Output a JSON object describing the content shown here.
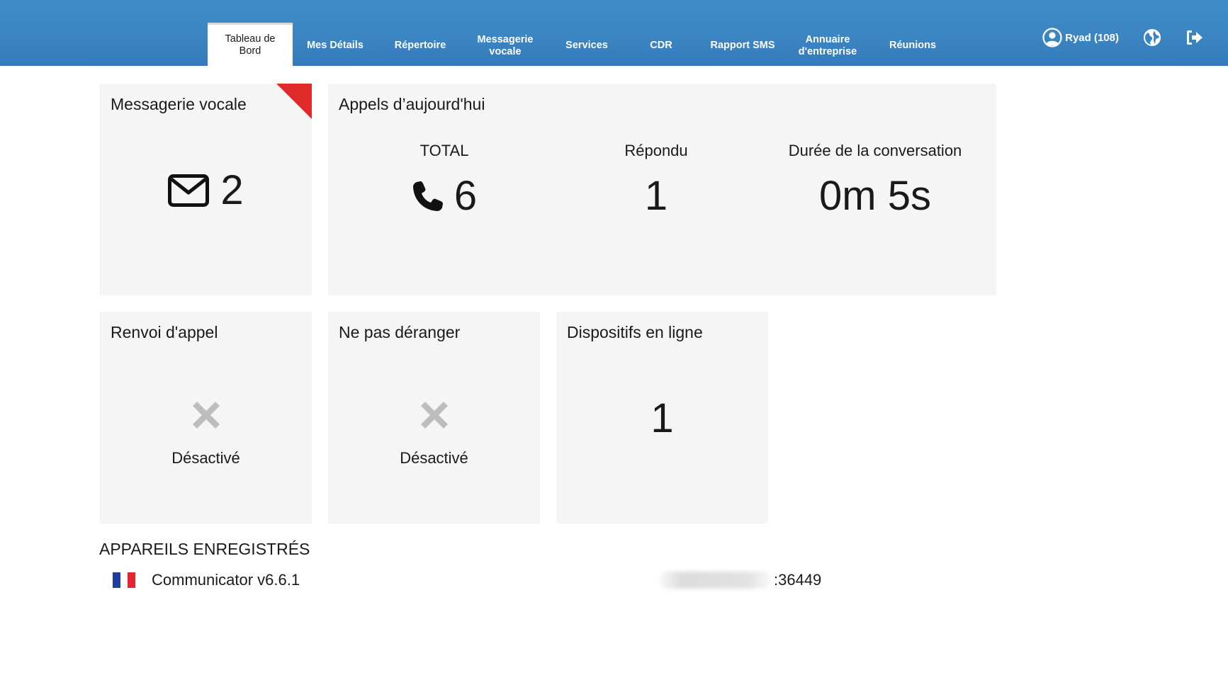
{
  "header": {
    "tabs": [
      {
        "label": "Tableau de Bord",
        "active": true
      },
      {
        "label": "Mes Détails",
        "active": false
      },
      {
        "label": "Répertoire",
        "active": false
      },
      {
        "label": "Messagerie vocale",
        "active": false
      },
      {
        "label": "Services",
        "active": false
      },
      {
        "label": "CDR",
        "active": false
      },
      {
        "label": "Rapport SMS",
        "active": false
      },
      {
        "label": "Annuaire d'entreprise",
        "active": false
      },
      {
        "label": "Réunions",
        "active": false
      }
    ],
    "user": {
      "label": "Ryad (108)",
      "icon": "user-circle-icon"
    },
    "language_icon": "globe-icon",
    "logout_icon": "logout-icon"
  },
  "voicemail": {
    "title": "Messagerie vocale",
    "count": "2",
    "icon": "envelope-icon",
    "flag_color": "#e12b2b"
  },
  "calls": {
    "title": "Appels d’aujourd'hui",
    "total_label": "TOTAL",
    "total_value": "6",
    "total_icon": "phone-icon",
    "answered_label": "Répondu",
    "answered_value": "1",
    "duration_label": "Durée de la conversation",
    "duration_value": "0m 5s"
  },
  "call_forward": {
    "title": "Renvoi d'appel",
    "status": "Désactivé",
    "icon": "x-icon"
  },
  "do_not_disturb": {
    "title": "Ne pas déranger",
    "status": "Désactivé",
    "icon": "x-icon"
  },
  "online_devices": {
    "title": "Dispositifs en ligne",
    "count": "1"
  },
  "registered_devices": {
    "title": "APPAREILS ENREGISTRÉS",
    "items": [
      {
        "name": "Communicator v6.6.1",
        "port": ":36449",
        "flag": "france-flag-icon"
      }
    ]
  },
  "colors": {
    "header_blue": "#3b84c2",
    "card_bg": "#f5f5f5",
    "status_icon_gray": "#bdbdbd",
    "flag_blue": "#1f3fa0",
    "flag_red": "#e3262f"
  }
}
